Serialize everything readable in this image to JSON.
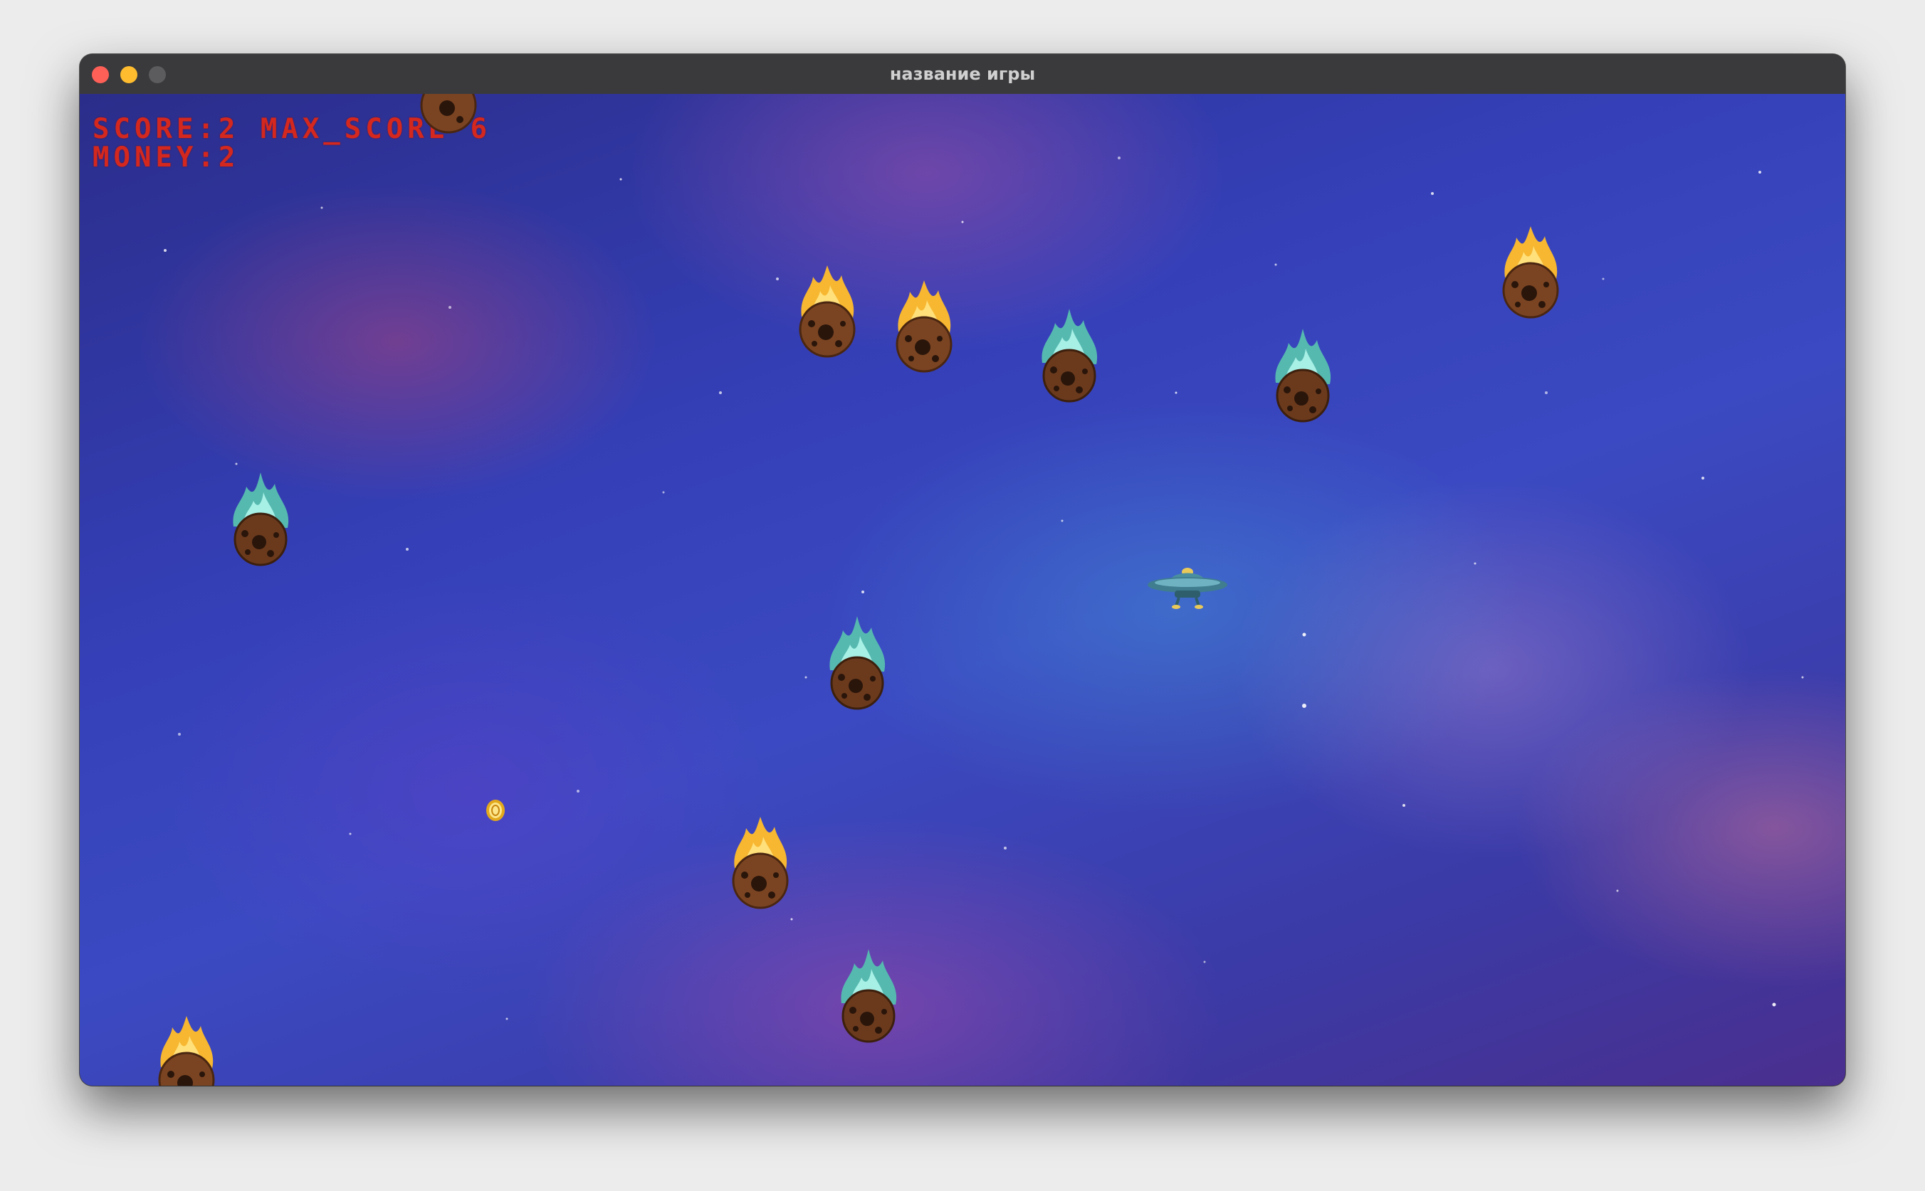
{
  "window": {
    "title": "название игры"
  },
  "hud": {
    "score_label": "SCORE:",
    "score": "2",
    "max_score_label": "MAX_SCORE",
    "max_score": "6",
    "money_label": "MONEY:",
    "money": "2"
  },
  "colors": {
    "hud_text": "#d4281f",
    "fire_meteor_flame": "#f7b731",
    "ice_meteor_flame": "#6fd3c9",
    "meteor_rock": "#6b3a1d"
  },
  "sprites": {
    "fire_meteor_icon": "fire-meteor-icon",
    "ice_meteor_icon": "ice-meteor-icon",
    "ufo_icon": "ufo-ship-icon",
    "coin_icon": "coin-icon"
  }
}
